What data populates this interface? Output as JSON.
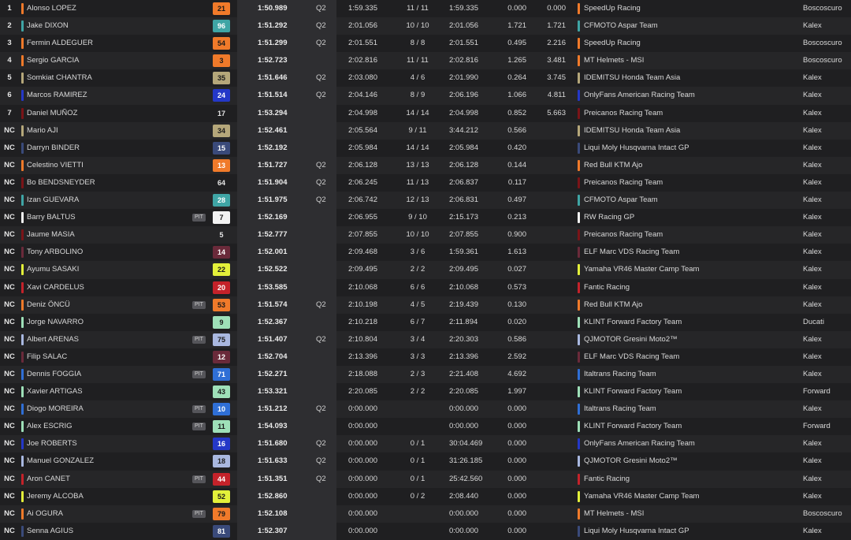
{
  "results": [
    {
      "pos": "1",
      "name": "Alonso LOPEZ",
      "pit": "",
      "num": "21",
      "best": "1:50.989",
      "q": "Q2",
      "last": "1:59.335",
      "laps": "11 / 11",
      "total": "1:59.335",
      "gap1": "0.000",
      "gap2": "0.000",
      "team": "SpeedUp Racing",
      "bike": "Boscoscuro",
      "color": "#f07a2a",
      "text_color": "#1a1a1a"
    },
    {
      "pos": "2",
      "name": "Jake DIXON",
      "pit": "",
      "num": "96",
      "best": "1:51.292",
      "q": "Q2",
      "last": "2:01.056",
      "laps": "10 / 10",
      "total": "2:01.056",
      "gap1": "1.721",
      "gap2": "1.721",
      "team": "CFMOTO Aspar Team",
      "bike": "Kalex",
      "color": "#3fa5a5",
      "text_color": "#ffffff"
    },
    {
      "pos": "3",
      "name": "Fermin ALDEGUER",
      "pit": "",
      "num": "54",
      "best": "1:51.299",
      "q": "Q2",
      "last": "2:01.551",
      "laps": "8 / 8",
      "total": "2:01.551",
      "gap1": "0.495",
      "gap2": "2.216",
      "team": "SpeedUp Racing",
      "bike": "Boscoscuro",
      "color": "#f07a2a",
      "text_color": "#1a1a1a"
    },
    {
      "pos": "4",
      "name": "Sergio GARCIA",
      "pit": "",
      "num": "3",
      "best": "1:52.723",
      "q": "",
      "last": "2:02.816",
      "laps": "11 / 11",
      "total": "2:02.816",
      "gap1": "1.265",
      "gap2": "3.481",
      "team": "MT Helmets - MSI",
      "bike": "Boscoscuro",
      "color": "#f07a2a",
      "text_color": "#1a1a1a"
    },
    {
      "pos": "5",
      "name": "Somkiat CHANTRA",
      "pit": "",
      "num": "35",
      "best": "1:51.646",
      "q": "Q2",
      "last": "2:03.080",
      "laps": "4 / 6",
      "total": "2:01.990",
      "gap1": "0.264",
      "gap2": "3.745",
      "team": "IDEMITSU Honda Team Asia",
      "bike": "Kalex",
      "color": "#b5a77a",
      "text_color": "#1a1a1a"
    },
    {
      "pos": "6",
      "name": "Marcos RAMIREZ",
      "pit": "",
      "num": "24",
      "best": "1:51.514",
      "q": "Q2",
      "last": "2:04.146",
      "laps": "8 / 9",
      "total": "2:06.196",
      "gap1": "1.066",
      "gap2": "4.811",
      "team": "OnlyFans American Racing Team",
      "bike": "Kalex",
      "color": "#2438c8",
      "text_color": "#ffffff"
    },
    {
      "pos": "7",
      "name": "Daniel MUÑOZ",
      "pit": "",
      "num": "17",
      "best": "1:53.294",
      "q": "",
      "last": "2:04.998",
      "laps": "14 / 14",
      "total": "2:04.998",
      "gap1": "0.852",
      "gap2": "5.663",
      "team": "Preicanos Racing Team",
      "bike": "Kalex",
      "color": "#7a1418",
      "text_color": "#ffffff"
    },
    {
      "pos": "NC",
      "name": "Mario AJI",
      "pit": "",
      "num": "34",
      "best": "1:52.461",
      "q": "",
      "last": "2:05.564",
      "laps": "9 / 11",
      "total": "3:44.212",
      "gap1": "0.566",
      "gap2": "",
      "team": "IDEMITSU Honda Team Asia",
      "bike": "Kalex",
      "color": "#b5a77a",
      "text_color": "#1a1a1a"
    },
    {
      "pos": "NC",
      "name": "Darryn BINDER",
      "pit": "",
      "num": "15",
      "best": "1:52.192",
      "q": "",
      "last": "2:05.984",
      "laps": "14 / 14",
      "total": "2:05.984",
      "gap1": "0.420",
      "gap2": "",
      "team": "Liqui Moly Husqvarna Intact GP",
      "bike": "Kalex",
      "color": "#3a4a7a",
      "text_color": "#ffffff"
    },
    {
      "pos": "NC",
      "name": "Celestino VIETTI",
      "pit": "",
      "num": "13",
      "best": "1:51.727",
      "q": "Q2",
      "last": "2:06.128",
      "laps": "13 / 13",
      "total": "2:06.128",
      "gap1": "0.144",
      "gap2": "",
      "team": "Red Bull KTM Ajo",
      "bike": "Kalex",
      "color": "#f07a2a",
      "text_color": "#ffffff"
    },
    {
      "pos": "NC",
      "name": "Bo BENDSNEYDER",
      "pit": "",
      "num": "64",
      "best": "1:51.904",
      "q": "Q2",
      "last": "2:06.245",
      "laps": "11 / 13",
      "total": "2:06.837",
      "gap1": "0.117",
      "gap2": "",
      "team": "Preicanos Racing Team",
      "bike": "Kalex",
      "color": "#7a1418",
      "text_color": "#ffffff"
    },
    {
      "pos": "NC",
      "name": "Izan GUEVARA",
      "pit": "",
      "num": "28",
      "best": "1:51.975",
      "q": "Q2",
      "last": "2:06.742",
      "laps": "12 / 13",
      "total": "2:06.831",
      "gap1": "0.497",
      "gap2": "",
      "team": "CFMOTO Aspar Team",
      "bike": "Kalex",
      "color": "#3fa5a5",
      "text_color": "#ffffff"
    },
    {
      "pos": "NC",
      "name": "Barry BALTUS",
      "pit": "PIT",
      "num": "7",
      "best": "1:52.169",
      "q": "",
      "last": "2:06.955",
      "laps": "9 / 10",
      "total": "2:15.173",
      "gap1": "0.213",
      "gap2": "",
      "team": "RW Racing GP",
      "bike": "Kalex",
      "color": "#f2f2f2",
      "text_color": "#1a1a1a"
    },
    {
      "pos": "NC",
      "name": "Jaume MASIA",
      "pit": "",
      "num": "5",
      "best": "1:52.777",
      "q": "",
      "last": "2:07.855",
      "laps": "10 / 10",
      "total": "2:07.855",
      "gap1": "0.900",
      "gap2": "",
      "team": "Preicanos Racing Team",
      "bike": "Kalex",
      "color": "#7a1418",
      "text_color": "#ffffff"
    },
    {
      "pos": "NC",
      "name": "Tony ARBOLINO",
      "pit": "",
      "num": "14",
      "best": "1:52.001",
      "q": "",
      "last": "2:09.468",
      "laps": "3 / 6",
      "total": "1:59.361",
      "gap1": "1.613",
      "gap2": "",
      "team": "ELF Marc VDS Racing Team",
      "bike": "Kalex",
      "color": "#6a2a3a",
      "text_color": "#ffffff"
    },
    {
      "pos": "NC",
      "name": "Ayumu SASAKI",
      "pit": "",
      "num": "22",
      "best": "1:52.522",
      "q": "",
      "last": "2:09.495",
      "laps": "2 / 2",
      "total": "2:09.495",
      "gap1": "0.027",
      "gap2": "",
      "team": "Yamaha VR46 Master Camp Team",
      "bike": "Kalex",
      "color": "#e3f03a",
      "text_color": "#1a1a1a"
    },
    {
      "pos": "NC",
      "name": "Xavi CARDELUS",
      "pit": "",
      "num": "20",
      "best": "1:53.585",
      "q": "",
      "last": "2:10.068",
      "laps": "6 / 6",
      "total": "2:10.068",
      "gap1": "0.573",
      "gap2": "",
      "team": "Fantic Racing",
      "bike": "Kalex",
      "color": "#c4222a",
      "text_color": "#ffffff"
    },
    {
      "pos": "NC",
      "name": "Deniz ÖNCÜ",
      "pit": "PIT",
      "num": "53",
      "best": "1:51.574",
      "q": "Q2",
      "last": "2:10.198",
      "laps": "4 / 5",
      "total": "2:19.439",
      "gap1": "0.130",
      "gap2": "",
      "team": "Red Bull KTM Ajo",
      "bike": "Kalex",
      "color": "#f07a2a",
      "text_color": "#1a1a1a"
    },
    {
      "pos": "NC",
      "name": "Jorge NAVARRO",
      "pit": "",
      "num": "9",
      "best": "1:52.367",
      "q": "",
      "last": "2:10.218",
      "laps": "6 / 7",
      "total": "2:11.894",
      "gap1": "0.020",
      "gap2": "",
      "team": "KLINT Forward Factory Team",
      "bike": "Ducati",
      "color": "#9ee0b8",
      "text_color": "#1a1a1a"
    },
    {
      "pos": "NC",
      "name": "Albert ARENAS",
      "pit": "PIT",
      "num": "75",
      "best": "1:51.407",
      "q": "Q2",
      "last": "2:10.804",
      "laps": "3 / 4",
      "total": "2:20.303",
      "gap1": "0.586",
      "gap2": "",
      "team": "QJMOTOR Gresini Moto2™",
      "bike": "Kalex",
      "color": "#a9b8e0",
      "text_color": "#1a1a1a"
    },
    {
      "pos": "NC",
      "name": "Filip SALAC",
      "pit": "",
      "num": "12",
      "best": "1:52.704",
      "q": "",
      "last": "2:13.396",
      "laps": "3 / 3",
      "total": "2:13.396",
      "gap1": "2.592",
      "gap2": "",
      "team": "ELF Marc VDS Racing Team",
      "bike": "Kalex",
      "color": "#6a2a3a",
      "text_color": "#ffffff"
    },
    {
      "pos": "NC",
      "name": "Dennis FOGGIA",
      "pit": "PIT",
      "num": "71",
      "best": "1:52.271",
      "q": "",
      "last": "2:18.088",
      "laps": "2 / 3",
      "total": "2:21.408",
      "gap1": "4.692",
      "gap2": "",
      "team": "Italtrans Racing Team",
      "bike": "Kalex",
      "color": "#2f6fd6",
      "text_color": "#ffffff"
    },
    {
      "pos": "NC",
      "name": "Xavier ARTIGAS",
      "pit": "",
      "num": "43",
      "best": "1:53.321",
      "q": "",
      "last": "2:20.085",
      "laps": "2 / 2",
      "total": "2:20.085",
      "gap1": "1.997",
      "gap2": "",
      "team": "KLINT Forward Factory Team",
      "bike": "Forward",
      "color": "#9ee0b8",
      "text_color": "#1a1a1a"
    },
    {
      "pos": "NC",
      "name": "Diogo MOREIRA",
      "pit": "PIT",
      "num": "10",
      "best": "1:51.212",
      "q": "Q2",
      "last": "0:00.000",
      "laps": "",
      "total": "0:00.000",
      "gap1": "0.000",
      "gap2": "",
      "team": "Italtrans Racing Team",
      "bike": "Kalex",
      "color": "#2f6fd6",
      "text_color": "#ffffff"
    },
    {
      "pos": "NC",
      "name": "Alex ESCRIG",
      "pit": "PIT",
      "num": "11",
      "best": "1:54.093",
      "q": "",
      "last": "0:00.000",
      "laps": "",
      "total": "0:00.000",
      "gap1": "0.000",
      "gap2": "",
      "team": "KLINT Forward Factory Team",
      "bike": "Forward",
      "color": "#9ee0b8",
      "text_color": "#1a1a1a"
    },
    {
      "pos": "NC",
      "name": "Joe ROBERTS",
      "pit": "",
      "num": "16",
      "best": "1:51.680",
      "q": "Q2",
      "last": "0:00.000",
      "laps": "0 / 1",
      "total": "30:04.469",
      "gap1": "0.000",
      "gap2": "",
      "team": "OnlyFans American Racing Team",
      "bike": "Kalex",
      "color": "#2438c8",
      "text_color": "#ffffff"
    },
    {
      "pos": "NC",
      "name": "Manuel GONZALEZ",
      "pit": "",
      "num": "18",
      "best": "1:51.633",
      "q": "Q2",
      "last": "0:00.000",
      "laps": "0 / 1",
      "total": "31:26.185",
      "gap1": "0.000",
      "gap2": "",
      "team": "QJMOTOR Gresini Moto2™",
      "bike": "Kalex",
      "color": "#a9b8e0",
      "text_color": "#1a1a1a"
    },
    {
      "pos": "NC",
      "name": "Aron CANET",
      "pit": "PIT",
      "num": "44",
      "best": "1:51.351",
      "q": "Q2",
      "last": "0:00.000",
      "laps": "0 / 1",
      "total": "25:42.560",
      "gap1": "0.000",
      "gap2": "",
      "team": "Fantic Racing",
      "bike": "Kalex",
      "color": "#c4222a",
      "text_color": "#ffffff"
    },
    {
      "pos": "NC",
      "name": "Jeremy ALCOBA",
      "pit": "",
      "num": "52",
      "best": "1:52.860",
      "q": "",
      "last": "0:00.000",
      "laps": "0 / 2",
      "total": "2:08.440",
      "gap1": "0.000",
      "gap2": "",
      "team": "Yamaha VR46 Master Camp Team",
      "bike": "Kalex",
      "color": "#e3f03a",
      "text_color": "#1a1a1a"
    },
    {
      "pos": "NC",
      "name": "Ai OGURA",
      "pit": "PIT",
      "num": "79",
      "best": "1:52.108",
      "q": "",
      "last": "0:00.000",
      "laps": "",
      "total": "0:00.000",
      "gap1": "0.000",
      "gap2": "",
      "team": "MT Helmets - MSI",
      "bike": "Boscoscuro",
      "color": "#f07a2a",
      "text_color": "#1a1a1a"
    },
    {
      "pos": "NC",
      "name": "Senna AGIUS",
      "pit": "",
      "num": "81",
      "best": "1:52.307",
      "q": "",
      "last": "0:00.000",
      "laps": "",
      "total": "0:00.000",
      "gap1": "0.000",
      "gap2": "",
      "team": "Liqui Moly Husqvarna Intact GP",
      "bike": "Kalex",
      "color": "#3a4a7a",
      "text_color": "#ffffff"
    }
  ]
}
